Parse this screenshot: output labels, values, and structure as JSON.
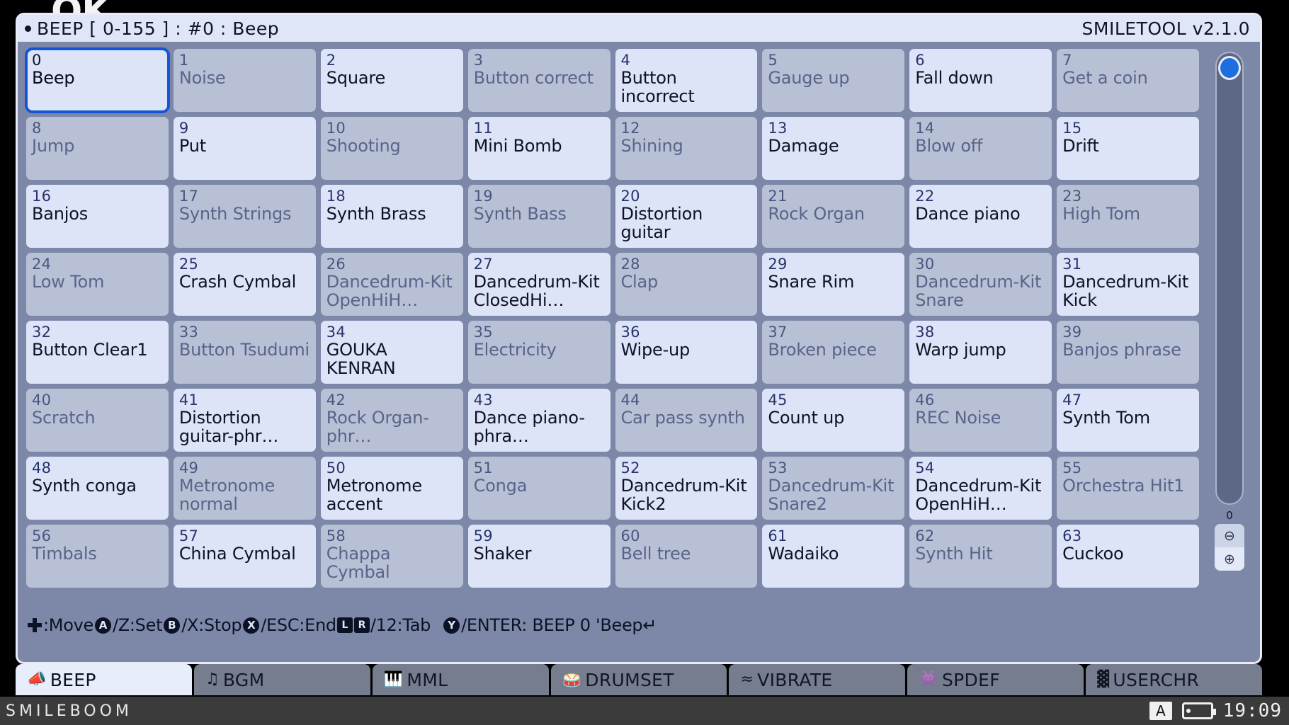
{
  "ghost_text": "OK",
  "titlebar": {
    "left": "BEEP [ 0-155 ] : #0 : Beep",
    "right": "SMILETOOL v2.1.0"
  },
  "grid": {
    "columns": 8,
    "cells": [
      {
        "num": "0",
        "label": "Beep",
        "style": "light",
        "selected": true
      },
      {
        "num": "1",
        "label": "Noise",
        "style": "dark",
        "selected": false
      },
      {
        "num": "2",
        "label": "Square",
        "style": "light",
        "selected": false
      },
      {
        "num": "3",
        "label": "Button correct",
        "style": "dark",
        "selected": false
      },
      {
        "num": "4",
        "label": "Button incorrect",
        "style": "light",
        "selected": false
      },
      {
        "num": "5",
        "label": "Gauge up",
        "style": "dark",
        "selected": false
      },
      {
        "num": "6",
        "label": "Fall down",
        "style": "light",
        "selected": false
      },
      {
        "num": "7",
        "label": "Get a coin",
        "style": "dark",
        "selected": false
      },
      {
        "num": "8",
        "label": "Jump",
        "style": "dark",
        "selected": false
      },
      {
        "num": "9",
        "label": "Put",
        "style": "light",
        "selected": false
      },
      {
        "num": "10",
        "label": "Shooting",
        "style": "dark",
        "selected": false
      },
      {
        "num": "11",
        "label": "Mini Bomb",
        "style": "light",
        "selected": false
      },
      {
        "num": "12",
        "label": "Shining",
        "style": "dark",
        "selected": false
      },
      {
        "num": "13",
        "label": "Damage",
        "style": "light",
        "selected": false
      },
      {
        "num": "14",
        "label": "Blow off",
        "style": "dark",
        "selected": false
      },
      {
        "num": "15",
        "label": "Drift",
        "style": "light",
        "selected": false
      },
      {
        "num": "16",
        "label": "Banjos",
        "style": "light",
        "selected": false
      },
      {
        "num": "17",
        "label": "Synth Strings",
        "style": "dark",
        "selected": false
      },
      {
        "num": "18",
        "label": "Synth Brass",
        "style": "light",
        "selected": false
      },
      {
        "num": "19",
        "label": "Synth Bass",
        "style": "dark",
        "selected": false
      },
      {
        "num": "20",
        "label": "Distortion guitar",
        "style": "light",
        "selected": false
      },
      {
        "num": "21",
        "label": "Rock Organ",
        "style": "dark",
        "selected": false
      },
      {
        "num": "22",
        "label": "Dance piano",
        "style": "light",
        "selected": false
      },
      {
        "num": "23",
        "label": "High Tom",
        "style": "dark",
        "selected": false
      },
      {
        "num": "24",
        "label": "Low Tom",
        "style": "dark",
        "selected": false
      },
      {
        "num": "25",
        "label": "Crash Cymbal",
        "style": "light",
        "selected": false
      },
      {
        "num": "26",
        "label": "Dancedrum-Kit OpenHiH…",
        "style": "dark",
        "selected": false
      },
      {
        "num": "27",
        "label": "Dancedrum-Kit ClosedHi…",
        "style": "light",
        "selected": false
      },
      {
        "num": "28",
        "label": "Clap",
        "style": "dark",
        "selected": false
      },
      {
        "num": "29",
        "label": "Snare Rim",
        "style": "light",
        "selected": false
      },
      {
        "num": "30",
        "label": "Dancedrum-Kit Snare",
        "style": "dark",
        "selected": false
      },
      {
        "num": "31",
        "label": "Dancedrum-Kit Kick",
        "style": "light",
        "selected": false
      },
      {
        "num": "32",
        "label": "Button Clear1",
        "style": "light",
        "selected": false
      },
      {
        "num": "33",
        "label": "Button Tsudumi",
        "style": "dark",
        "selected": false
      },
      {
        "num": "34",
        "label": "GOUKA KENRAN",
        "style": "light",
        "selected": false
      },
      {
        "num": "35",
        "label": "Electricity",
        "style": "dark",
        "selected": false
      },
      {
        "num": "36",
        "label": "Wipe-up",
        "style": "light",
        "selected": false
      },
      {
        "num": "37",
        "label": "Broken piece",
        "style": "dark",
        "selected": false
      },
      {
        "num": "38",
        "label": "Warp jump",
        "style": "light",
        "selected": false
      },
      {
        "num": "39",
        "label": "Banjos phrase",
        "style": "dark",
        "selected": false
      },
      {
        "num": "40",
        "label": "Scratch",
        "style": "dark",
        "selected": false
      },
      {
        "num": "41",
        "label": "Distortion guitar-phr…",
        "style": "light",
        "selected": false
      },
      {
        "num": "42",
        "label": "Rock Organ-phr…",
        "style": "dark",
        "selected": false
      },
      {
        "num": "43",
        "label": "Dance piano-phra…",
        "style": "light",
        "selected": false
      },
      {
        "num": "44",
        "label": "Car pass synth",
        "style": "dark",
        "selected": false
      },
      {
        "num": "45",
        "label": "Count up",
        "style": "light",
        "selected": false
      },
      {
        "num": "46",
        "label": "REC Noise",
        "style": "dark",
        "selected": false
      },
      {
        "num": "47",
        "label": "Synth Tom",
        "style": "light",
        "selected": false
      },
      {
        "num": "48",
        "label": "Synth conga",
        "style": "light",
        "selected": false
      },
      {
        "num": "49",
        "label": "Metronome normal",
        "style": "dark",
        "selected": false
      },
      {
        "num": "50",
        "label": "Metronome accent",
        "style": "light",
        "selected": false
      },
      {
        "num": "51",
        "label": "Conga",
        "style": "dark",
        "selected": false
      },
      {
        "num": "52",
        "label": "Dancedrum-Kit Kick2",
        "style": "light",
        "selected": false
      },
      {
        "num": "53",
        "label": "Dancedrum-Kit Snare2",
        "style": "dark",
        "selected": false
      },
      {
        "num": "54",
        "label": "Dancedrum-Kit OpenHiH…",
        "style": "light",
        "selected": false
      },
      {
        "num": "55",
        "label": "Orchestra Hit1",
        "style": "dark",
        "selected": false
      },
      {
        "num": "56",
        "label": "Timbals",
        "style": "dark",
        "selected": false
      },
      {
        "num": "57",
        "label": "China Cymbal",
        "style": "light",
        "selected": false
      },
      {
        "num": "58",
        "label": "Chappa Cymbal",
        "style": "dark",
        "selected": false
      },
      {
        "num": "59",
        "label": "Shaker",
        "style": "light",
        "selected": false
      },
      {
        "num": "60",
        "label": "Bell tree",
        "style": "dark",
        "selected": false
      },
      {
        "num": "61",
        "label": "Wadaiko",
        "style": "light",
        "selected": false
      },
      {
        "num": "62",
        "label": "Synth Hit",
        "style": "dark",
        "selected": false
      },
      {
        "num": "63",
        "label": "Cuckoo",
        "style": "light",
        "selected": false
      }
    ]
  },
  "scrollbar": {
    "value": "0",
    "minus_glyph": "⊖",
    "plus_glyph": "⊕"
  },
  "helpbar": {
    "move_label": ":Move",
    "a_btn": "A",
    "set_label": "/Z:Set",
    "b_btn": "B",
    "stop_label": "/X:Stop",
    "x_btn": "X",
    "end_label": "/ESC:End",
    "l_btn": "L",
    "r_btn": "R",
    "tab_label": "/12:Tab",
    "y_btn": "Y",
    "enter_label": "/ENTER: BEEP 0 'Beep↵"
  },
  "tabs": [
    {
      "label": "BEEP",
      "icon": "📣",
      "icon_name": "megaphone-icon",
      "active": true
    },
    {
      "label": "BGM",
      "icon": "♫",
      "icon_name": "music-note-icon",
      "active": false
    },
    {
      "label": "MML",
      "icon": "🎹",
      "icon_name": "piano-keys-icon",
      "active": false
    },
    {
      "label": "DRUMSET",
      "icon": "🥁",
      "icon_name": "drum-icon",
      "active": false
    },
    {
      "label": "VIBRATE",
      "icon": "≈",
      "icon_name": "wave-icon",
      "active": false
    },
    {
      "label": "SPDEF",
      "icon": "👾",
      "icon_name": "sprite-icon",
      "active": false
    },
    {
      "label": "USERCHR",
      "icon": "▓",
      "icon_name": "grid-pattern-icon",
      "active": false
    }
  ],
  "osbar": {
    "brand": "SMILEBOOM",
    "keyboard_indicator": "A",
    "battery_name": "battery-icon",
    "clock": "19:09"
  },
  "colors": {
    "accent": "#1455d8",
    "window_bg": "#7d88a8",
    "cell_light": "#dde4f8",
    "cell_dark": "#b8c0d6",
    "titlebar": "#dfe6f8"
  }
}
